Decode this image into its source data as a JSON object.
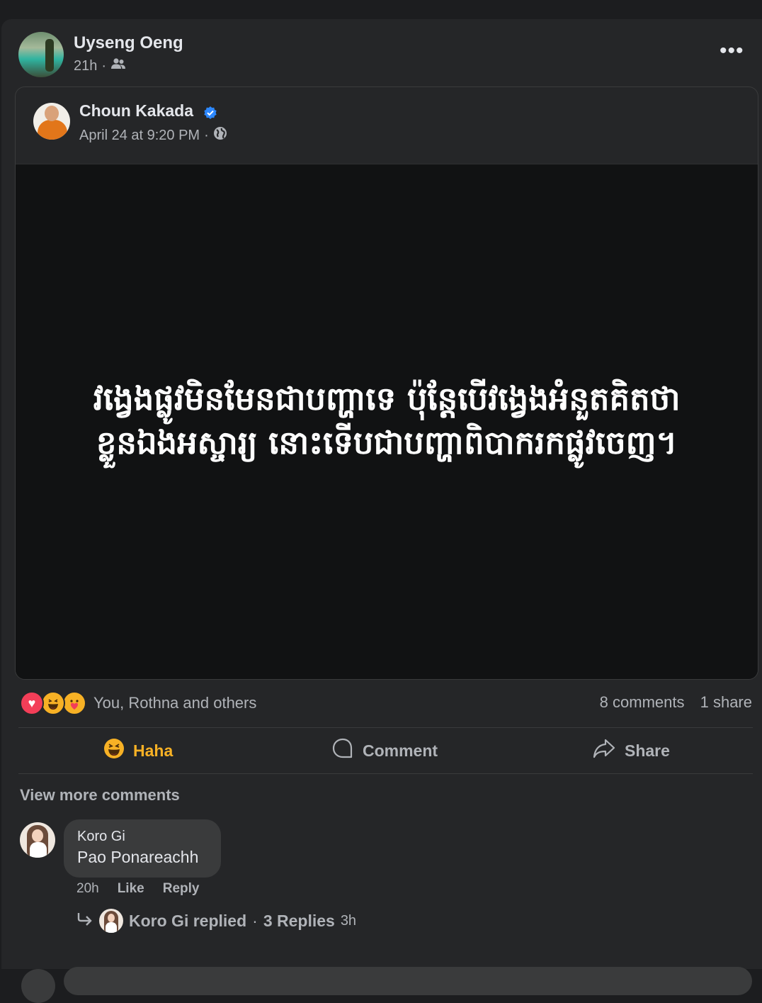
{
  "post": {
    "author": "Uyseng Oeng",
    "time": "21h",
    "separator": "·",
    "audience_icon": "friends-icon",
    "more_icon": "more-options-icon",
    "more_label": "•••"
  },
  "shared": {
    "author": "Choun Kakada",
    "verified_icon": "verified-badge-icon",
    "time": "April 24 at 9:20 PM",
    "separator": "·",
    "audience_icon": "globe-icon",
    "image_text_line1": "វង្វេងផ្លូវមិនមែនជាបញ្ហាទេ ប៉ុន្តែបើវង្វេងអំនួតគិតថា",
    "image_text_line2": "ខ្លួនឯងអស្ចារ្យ នោះទើបជាបញ្ហាពិបាករកផ្លូវចេញ។"
  },
  "reactions": {
    "icons": [
      "love",
      "haha",
      "care"
    ],
    "love_glyph": "♥",
    "summary": "You, Rothna and others",
    "comments_count": "8 comments",
    "shares_count": "1 share"
  },
  "actions": {
    "reaction_label": "Haha",
    "reaction_icon": "haha-emoji-icon",
    "comment_label": "Comment",
    "comment_icon": "comment-bubble-icon",
    "share_label": "Share",
    "share_icon": "share-arrow-icon"
  },
  "comments": {
    "view_more": "View more comments",
    "items": [
      {
        "author": "Koro Gi",
        "text": "Pao Ponareachh",
        "time": "20h",
        "like_label": "Like",
        "reply_label": "Reply",
        "replies_summary": {
          "replier": "Koro Gi replied",
          "separator": "·",
          "count": "3 Replies",
          "time": "3h"
        }
      }
    ]
  },
  "colors": {
    "background": "#1c1d1f",
    "card": "#252628",
    "bubble": "#3a3b3c",
    "text_primary": "#e4e6eb",
    "text_secondary": "#b0b3b8",
    "haha_accent": "#f7b125",
    "verified_blue": "#2d88ff",
    "love_red": "#f33e58"
  }
}
